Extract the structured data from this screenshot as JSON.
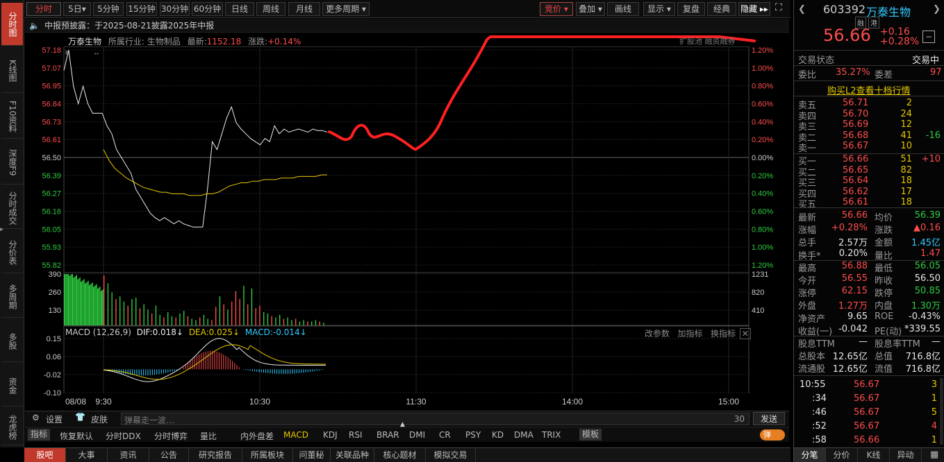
{
  "left_nav": [
    {
      "label": "分时图",
      "active": true
    },
    {
      "label": "K线图",
      "active": false
    },
    {
      "label": "F10资料",
      "active": false
    },
    {
      "label": "深度F9",
      "active": false
    },
    {
      "label": "分时成交",
      "active": false
    },
    {
      "label": "分价表",
      "active": false
    },
    {
      "label": "多周期",
      "active": false
    },
    {
      "label": "多股",
      "active": false
    },
    {
      "label": "资金",
      "active": false
    },
    {
      "label": "龙虎榜",
      "active": false
    }
  ],
  "toolbar": {
    "periods": [
      "分时",
      "5日▾",
      "5分钟",
      "15分钟",
      "30分钟",
      "60分钟",
      "日线",
      "周线",
      "月线",
      "更多周期 ▾"
    ],
    "right": [
      "竞价 ▾",
      "叠加 ▾",
      "画线",
      "显示 ▾",
      "复盘",
      "经典",
      "隐藏 ▸▸"
    ]
  },
  "notice": {
    "icon": "speaker-icon",
    "text": "中报预披露：于2025-08-21披露2025年中报"
  },
  "chart_header": {
    "name": "万泰生物",
    "industry_label": "所属行业:",
    "industry": "生物制品",
    "latest_label": "最新:",
    "latest": "1152.18",
    "change_label": "涨跌:",
    "change": "+0.14%",
    "right_links": "扩股池  融资融券"
  },
  "chart_data": [
    {
      "type": "line",
      "name": "price",
      "y_ticks": [
        "57.18",
        "57.07",
        "56.95",
        "56.84",
        "56.73",
        "56.61",
        "56.50",
        "56.39",
        "56.27",
        "56.16",
        "56.05",
        "55.93",
        "55.82"
      ],
      "pct_ticks": [
        "1.20%",
        "1.00%",
        "0.80%",
        "0.60%",
        "0.40%",
        "0.20%",
        "0.00%",
        "0.20%",
        "0.40%",
        "0.60%",
        "0.80%",
        "1.00%",
        "1.20%"
      ],
      "ylim": [
        55.82,
        57.18
      ],
      "series": [
        {
          "values": [
            57.05,
            57.18,
            56.95,
            56.84,
            56.95,
            56.84,
            56.78,
            56.78,
            56.78,
            56.7,
            56.65,
            56.55,
            56.5,
            56.45,
            56.4,
            56.3,
            56.25,
            56.2,
            56.15,
            56.12,
            56.1,
            56.12,
            56.1,
            56.08,
            56.1,
            56.08,
            56.07,
            56.06,
            56.06,
            56.06,
            56.3,
            56.6,
            56.55,
            56.65,
            56.75,
            56.82,
            56.72,
            56.68,
            56.65,
            56.62,
            56.6,
            56.58,
            56.62,
            56.6,
            56.7,
            56.65,
            56.68,
            56.66,
            56.67,
            56.68,
            56.67,
            56.66,
            56.68,
            56.67,
            56.67,
            56.66
          ]
        },
        {
          "values": [
            56.55,
            56.48,
            56.43,
            56.4,
            56.37,
            56.35,
            56.33,
            56.31,
            56.3,
            56.29,
            56.28,
            56.28,
            56.27,
            56.27,
            56.27,
            56.26,
            56.26,
            56.26,
            56.27,
            56.27,
            56.28,
            56.3,
            56.32,
            56.33,
            56.34,
            56.34,
            56.35,
            56.35,
            56.36,
            56.36,
            56.36,
            56.37,
            56.37,
            56.37,
            56.38,
            56.38,
            56.38,
            56.38,
            56.39,
            56.39
          ]
        }
      ]
    },
    {
      "type": "bar",
      "name": "volume",
      "y_ticks": [
        "390",
        "260",
        "130"
      ],
      "right_ticks": [
        "1231",
        "820",
        "410"
      ],
      "ylim": [
        0,
        390
      ],
      "values": [
        380,
        320,
        250,
        200,
        220,
        180,
        150,
        200,
        210,
        130,
        160,
        120,
        90,
        150,
        80,
        60,
        100,
        70,
        60,
        90,
        110,
        70,
        50,
        40,
        60,
        80,
        50,
        40,
        140,
        220,
        160,
        120,
        180,
        260,
        200,
        300,
        160,
        280,
        130,
        150,
        100,
        90,
        70,
        60,
        80,
        50,
        60,
        40,
        50,
        30,
        40,
        30,
        30,
        40,
        30,
        20
      ]
    },
    {
      "type": "line",
      "name": "macd",
      "title": "MACD (12,26,9)",
      "y_ticks": [
        "0.15",
        "0.06",
        "-0.02",
        "-0.10"
      ],
      "ylim": [
        -0.11,
        0.17
      ]
    }
  ],
  "macd_legend": {
    "dif": "DIF:0.018↓",
    "dea": "DEA:0.025↓",
    "macd": "MACD:-0.014↓",
    "links": [
      "改参数",
      "加指标",
      "换指标"
    ]
  },
  "x_axis": [
    "08/08",
    "9:30",
    "10:30",
    "11:30",
    "14:00",
    "15:00"
  ],
  "comment_bar": {
    "settings": "设置",
    "skin": "皮肤",
    "placeholder": "弹幕走一波…",
    "count": "30",
    "send": "发送"
  },
  "indicator_tabs": [
    "指标",
    "恢复默认",
    "分时DDX",
    "分时博弈",
    "量比",
    "内外盘差",
    "MACD",
    "KDJ",
    "RSI",
    "BRAR",
    "DMI",
    "CR",
    "PSY",
    "KD",
    "DMA",
    "TRIX",
    "模板"
  ],
  "danmu_toggle": "弹",
  "bottom_tabs": [
    "股吧",
    "大事",
    "资讯",
    "公告",
    "研究报告",
    "所属板块",
    "问董秘",
    "关联品种",
    "核心题材",
    "模拟交易"
  ],
  "right_panel": {
    "code": "603392",
    "name": "万泰生物",
    "tags": [
      "融",
      "港"
    ],
    "price": "56.66",
    "change": "+0.16",
    "change_pct": "+0.28%",
    "status_label": "交易状态",
    "status": "交易中",
    "weibi_label": "委比",
    "weibi": "35.27%",
    "weicha_label": "委差",
    "weicha": "97",
    "l2_link": "购买L2查看十档行情",
    "asks": [
      {
        "label": "卖五",
        "price": "56.71",
        "vol": "2",
        "chg": ""
      },
      {
        "label": "卖四",
        "price": "56.70",
        "vol": "24",
        "chg": ""
      },
      {
        "label": "卖三",
        "price": "56.69",
        "vol": "12",
        "chg": ""
      },
      {
        "label": "卖二",
        "price": "56.68",
        "vol": "41",
        "chg": "-16"
      },
      {
        "label": "卖一",
        "price": "56.67",
        "vol": "10",
        "chg": ""
      }
    ],
    "bids": [
      {
        "label": "买一",
        "price": "56.66",
        "vol": "51",
        "chg": "+10"
      },
      {
        "label": "买二",
        "price": "56.65",
        "vol": "82",
        "chg": ""
      },
      {
        "label": "买三",
        "price": "56.64",
        "vol": "18",
        "chg": ""
      },
      {
        "label": "买四",
        "price": "56.62",
        "vol": "17",
        "chg": ""
      },
      {
        "label": "买五",
        "price": "56.61",
        "vol": "18",
        "chg": ""
      }
    ],
    "stats": [
      {
        "l1": "最新",
        "v1": "56.66",
        "c1": "r",
        "l2": "均价",
        "v2": "56.39",
        "c2": "g"
      },
      {
        "l1": "涨幅",
        "v1": "+0.28%",
        "c1": "r",
        "l2": "涨跌",
        "v2": "▲0.16",
        "c2": "r"
      },
      {
        "l1": "总手",
        "v1": "2.57万",
        "c1": "w",
        "l2": "金额",
        "v2": "1.45亿",
        "c2": "c"
      },
      {
        "l1": "换手*",
        "v1": "0.20%",
        "c1": "w",
        "l2": "量比",
        "v2": "1.47",
        "c2": "r"
      },
      {
        "l1": "最高",
        "v1": "56.88",
        "c1": "r",
        "l2": "最低",
        "v2": "56.05",
        "c2": "g"
      },
      {
        "l1": "今开",
        "v1": "56.55",
        "c1": "r",
        "l2": "昨收",
        "v2": "56.50",
        "c2": "w"
      },
      {
        "l1": "涨停",
        "v1": "62.15",
        "c1": "r",
        "l2": "跌停",
        "v2": "50.85",
        "c2": "g"
      },
      {
        "l1": "外盘",
        "v1": "1.27万",
        "c1": "r",
        "l2": "内盘",
        "v2": "1.30万",
        "c2": "g"
      },
      {
        "l1": "净资产",
        "v1": "9.65",
        "c1": "w",
        "l2": "ROE",
        "v2": "-0.43%",
        "c2": "w"
      },
      {
        "l1": "收益(一)",
        "v1": "-0.042",
        "c1": "w",
        "l2": "PE(动)",
        "v2": "*339.55",
        "c2": "w"
      },
      {
        "l1": "股息TTM",
        "v1": "—",
        "c1": "w",
        "l2": "股息率TTM",
        "v2": "—",
        "c2": "w"
      },
      {
        "l1": "总股本",
        "v1": "12.65亿",
        "c1": "w",
        "l2": "总值",
        "v2": "716.8亿",
        "c2": "w"
      },
      {
        "l1": "流通股",
        "v1": "12.65亿",
        "c1": "w",
        "l2": "流值",
        "v2": "716.8亿",
        "c2": "w"
      }
    ],
    "ticks": [
      {
        "time": "10:55",
        "price": "56.67",
        "vol": "3",
        "vc": "y"
      },
      {
        "time": ":34",
        "price": "56.67",
        "vol": "1",
        "vc": "y"
      },
      {
        "time": ":46",
        "price": "56.67",
        "vol": "5",
        "vc": "y"
      },
      {
        "time": ":52",
        "price": "56.67",
        "vol": "4",
        "vc": "r"
      },
      {
        "time": ":58",
        "price": "56.66",
        "vol": "1",
        "vc": "y"
      }
    ],
    "tabs": [
      "分笔",
      "分价",
      "K线",
      "异动"
    ]
  },
  "colors": {
    "up": "#ff4d4d",
    "down": "#2ecc40",
    "avg": "#e6c700",
    "drawn": "#ff2020"
  }
}
